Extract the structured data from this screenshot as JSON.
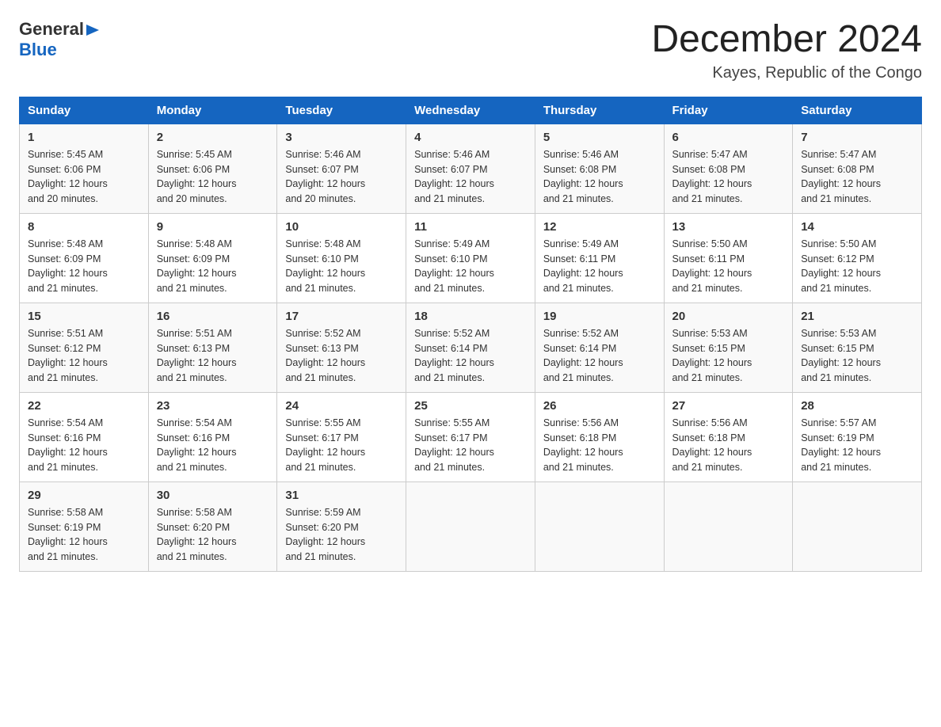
{
  "header": {
    "logo_general": "General",
    "logo_blue": "Blue",
    "title": "December 2024",
    "subtitle": "Kayes, Republic of the Congo"
  },
  "days_of_week": [
    "Sunday",
    "Monday",
    "Tuesday",
    "Wednesday",
    "Thursday",
    "Friday",
    "Saturday"
  ],
  "weeks": [
    [
      {
        "day": "1",
        "sunrise": "5:45 AM",
        "sunset": "6:06 PM",
        "daylight": "12 hours and 20 minutes."
      },
      {
        "day": "2",
        "sunrise": "5:45 AM",
        "sunset": "6:06 PM",
        "daylight": "12 hours and 20 minutes."
      },
      {
        "day": "3",
        "sunrise": "5:46 AM",
        "sunset": "6:07 PM",
        "daylight": "12 hours and 20 minutes."
      },
      {
        "day": "4",
        "sunrise": "5:46 AM",
        "sunset": "6:07 PM",
        "daylight": "12 hours and 21 minutes."
      },
      {
        "day": "5",
        "sunrise": "5:46 AM",
        "sunset": "6:08 PM",
        "daylight": "12 hours and 21 minutes."
      },
      {
        "day": "6",
        "sunrise": "5:47 AM",
        "sunset": "6:08 PM",
        "daylight": "12 hours and 21 minutes."
      },
      {
        "day": "7",
        "sunrise": "5:47 AM",
        "sunset": "6:08 PM",
        "daylight": "12 hours and 21 minutes."
      }
    ],
    [
      {
        "day": "8",
        "sunrise": "5:48 AM",
        "sunset": "6:09 PM",
        "daylight": "12 hours and 21 minutes."
      },
      {
        "day": "9",
        "sunrise": "5:48 AM",
        "sunset": "6:09 PM",
        "daylight": "12 hours and 21 minutes."
      },
      {
        "day": "10",
        "sunrise": "5:48 AM",
        "sunset": "6:10 PM",
        "daylight": "12 hours and 21 minutes."
      },
      {
        "day": "11",
        "sunrise": "5:49 AM",
        "sunset": "6:10 PM",
        "daylight": "12 hours and 21 minutes."
      },
      {
        "day": "12",
        "sunrise": "5:49 AM",
        "sunset": "6:11 PM",
        "daylight": "12 hours and 21 minutes."
      },
      {
        "day": "13",
        "sunrise": "5:50 AM",
        "sunset": "6:11 PM",
        "daylight": "12 hours and 21 minutes."
      },
      {
        "day": "14",
        "sunrise": "5:50 AM",
        "sunset": "6:12 PM",
        "daylight": "12 hours and 21 minutes."
      }
    ],
    [
      {
        "day": "15",
        "sunrise": "5:51 AM",
        "sunset": "6:12 PM",
        "daylight": "12 hours and 21 minutes."
      },
      {
        "day": "16",
        "sunrise": "5:51 AM",
        "sunset": "6:13 PM",
        "daylight": "12 hours and 21 minutes."
      },
      {
        "day": "17",
        "sunrise": "5:52 AM",
        "sunset": "6:13 PM",
        "daylight": "12 hours and 21 minutes."
      },
      {
        "day": "18",
        "sunrise": "5:52 AM",
        "sunset": "6:14 PM",
        "daylight": "12 hours and 21 minutes."
      },
      {
        "day": "19",
        "sunrise": "5:52 AM",
        "sunset": "6:14 PM",
        "daylight": "12 hours and 21 minutes."
      },
      {
        "day": "20",
        "sunrise": "5:53 AM",
        "sunset": "6:15 PM",
        "daylight": "12 hours and 21 minutes."
      },
      {
        "day": "21",
        "sunrise": "5:53 AM",
        "sunset": "6:15 PM",
        "daylight": "12 hours and 21 minutes."
      }
    ],
    [
      {
        "day": "22",
        "sunrise": "5:54 AM",
        "sunset": "6:16 PM",
        "daylight": "12 hours and 21 minutes."
      },
      {
        "day": "23",
        "sunrise": "5:54 AM",
        "sunset": "6:16 PM",
        "daylight": "12 hours and 21 minutes."
      },
      {
        "day": "24",
        "sunrise": "5:55 AM",
        "sunset": "6:17 PM",
        "daylight": "12 hours and 21 minutes."
      },
      {
        "day": "25",
        "sunrise": "5:55 AM",
        "sunset": "6:17 PM",
        "daylight": "12 hours and 21 minutes."
      },
      {
        "day": "26",
        "sunrise": "5:56 AM",
        "sunset": "6:18 PM",
        "daylight": "12 hours and 21 minutes."
      },
      {
        "day": "27",
        "sunrise": "5:56 AM",
        "sunset": "6:18 PM",
        "daylight": "12 hours and 21 minutes."
      },
      {
        "day": "28",
        "sunrise": "5:57 AM",
        "sunset": "6:19 PM",
        "daylight": "12 hours and 21 minutes."
      }
    ],
    [
      {
        "day": "29",
        "sunrise": "5:58 AM",
        "sunset": "6:19 PM",
        "daylight": "12 hours and 21 minutes."
      },
      {
        "day": "30",
        "sunrise": "5:58 AM",
        "sunset": "6:20 PM",
        "daylight": "12 hours and 21 minutes."
      },
      {
        "day": "31",
        "sunrise": "5:59 AM",
        "sunset": "6:20 PM",
        "daylight": "12 hours and 21 minutes."
      },
      {
        "day": "",
        "sunrise": "",
        "sunset": "",
        "daylight": ""
      },
      {
        "day": "",
        "sunrise": "",
        "sunset": "",
        "daylight": ""
      },
      {
        "day": "",
        "sunrise": "",
        "sunset": "",
        "daylight": ""
      },
      {
        "day": "",
        "sunrise": "",
        "sunset": "",
        "daylight": ""
      }
    ]
  ],
  "labels": {
    "sunrise": "Sunrise:",
    "sunset": "Sunset:",
    "daylight": "Daylight:"
  }
}
